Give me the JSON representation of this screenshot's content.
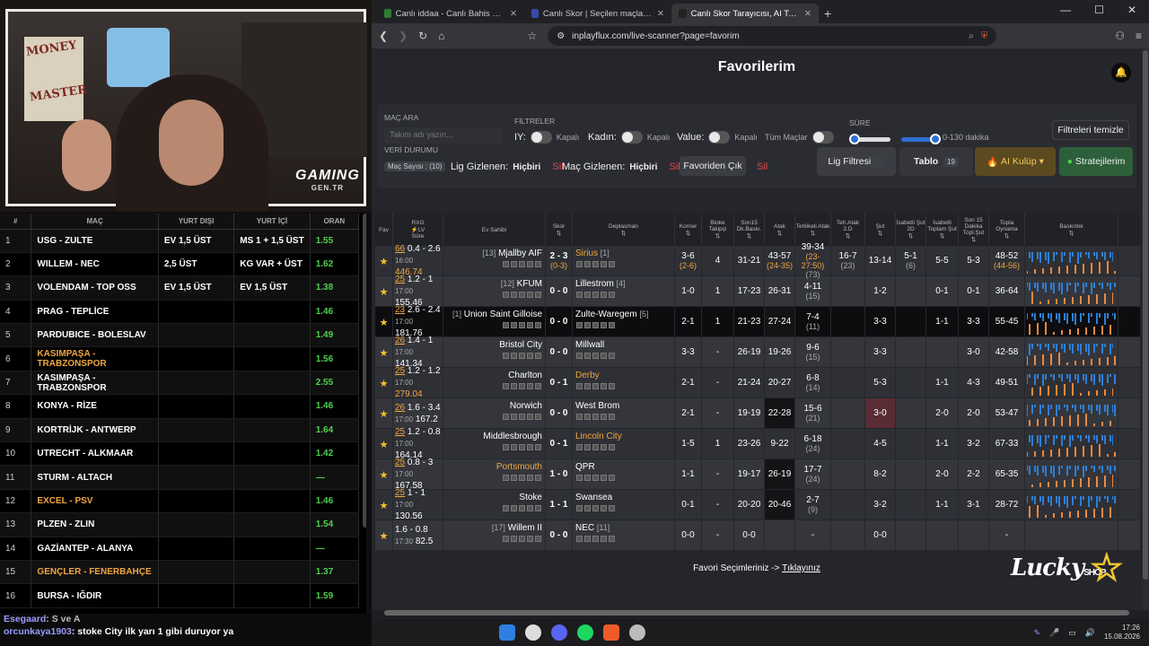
{
  "stream": {
    "logo_text": "GAMING",
    "logo_sub": "GEN.TR",
    "poster_text_1": "MONEY",
    "poster_text_2": "MASTER"
  },
  "left_table": {
    "headers": [
      "#",
      "MAÇ",
      "YURT DIŞI",
      "YURT İÇİ",
      "ORAN"
    ],
    "rows": [
      {
        "n": "1",
        "match": "USG - ZULTE",
        "abroad": "EV 1,5 ÜST",
        "domestic": "MS 1 + 1,5 ÜST",
        "odds": "1.55",
        "highlight": false
      },
      {
        "n": "2",
        "match": "WILLEM - NEC",
        "abroad": "2,5 ÜST",
        "domestic": "KG VAR + ÜST",
        "odds": "1.62",
        "highlight": false
      },
      {
        "n": "3",
        "match": "VOLENDAM - TOP OSS",
        "abroad": "EV 1,5 ÜST",
        "domestic": "EV 1,5 ÜST",
        "odds": "1.38",
        "highlight": false
      },
      {
        "n": "4",
        "match": "PRAG - TEPLİCE",
        "abroad": "",
        "domestic": "",
        "odds": "1.46",
        "highlight": false
      },
      {
        "n": "5",
        "match": "PARDUBICE - BOLESLAV",
        "abroad": "",
        "domestic": "",
        "odds": "1.49",
        "highlight": false
      },
      {
        "n": "6",
        "match": "KASIMPAŞA - TRABZONSPOR",
        "abroad": "",
        "domestic": "",
        "odds": "1.56",
        "highlight": true
      },
      {
        "n": "7",
        "match": "KASIMPAŞA - TRABZONSPOR",
        "abroad": "",
        "domestic": "",
        "odds": "2.55",
        "highlight": false
      },
      {
        "n": "8",
        "match": "KONYA - RİZE",
        "abroad": "",
        "domestic": "",
        "odds": "1.46",
        "highlight": false
      },
      {
        "n": "9",
        "match": "KORTRİJK - ANTWERP",
        "abroad": "",
        "domestic": "",
        "odds": "1.64",
        "highlight": false
      },
      {
        "n": "10",
        "match": "UTRECHT - ALKMAAR",
        "abroad": "",
        "domestic": "",
        "odds": "1.42",
        "highlight": false
      },
      {
        "n": "11",
        "match": "STURM - ALTACH",
        "abroad": "",
        "domestic": "",
        "odds": "—",
        "highlight": false
      },
      {
        "n": "12",
        "match": "EXCEL - PSV",
        "abroad": "",
        "domestic": "",
        "odds": "1.46",
        "highlight": true
      },
      {
        "n": "13",
        "match": "PLZEN - ZLIN",
        "abroad": "",
        "domestic": "",
        "odds": "1.54",
        "highlight": false
      },
      {
        "n": "14",
        "match": "GAZİANTEP - ALANYA",
        "abroad": "",
        "domestic": "",
        "odds": "—",
        "highlight": false
      },
      {
        "n": "15",
        "match": "GENÇLER - FENERBAHÇE",
        "abroad": "",
        "domestic": "",
        "odds": "1.37",
        "highlight": true
      },
      {
        "n": "16",
        "match": "BURSA - IĞDIR",
        "abroad": "",
        "domestic": "",
        "odds": "1.59",
        "highlight": false
      }
    ]
  },
  "chat": [
    {
      "user": "Esegaard",
      "text": ": S ve A"
    },
    {
      "user": "orcunkaya1903",
      "text": ": stoke City ilk yarı 1 gibi duruyor ya"
    }
  ],
  "browser": {
    "tabs": [
      {
        "label": "Canlı iddaa - Canlı Bahis Oyna | iddaa",
        "color": "#2e7d32"
      },
      {
        "label": "Canlı Skor | Seçilen maçlar için canlı",
        "color": "#3949ab"
      },
      {
        "label": "Canlı Skor Tarayıcısı, AI Tahminle",
        "color": "#222222"
      }
    ],
    "url": "inplayflux.com/live-scanner?page=favorim"
  },
  "page": {
    "title": "Favorilerim",
    "filters": {
      "mac_ara": "MAÇ ARA",
      "search_placeholder": "Takım adı yazın...",
      "filtreler": "FİLTRELER",
      "iy": "IY:",
      "kadin": "Kadın:",
      "value": "Value:",
      "tum": "Tüm Maçlar",
      "kapali": "Kapalı",
      "sure": "SÜRE",
      "range": "0-130 dakika",
      "temizle": "Filtreleri temizle",
      "veri": "VERİ DURUMU",
      "mac_sayisi": "Maç Sayısı : (10)",
      "lig_gizlenen": "Lig Gizlenen:",
      "mac_gizlenen": "Maç Gizlenen:",
      "hicbiri": "Hiçbiri",
      "sil": "Sil",
      "favoriden": "Favoriden Çık",
      "lig_filtresi": "Lig Filtresi",
      "tablo": "Tablo",
      "tablo_n": "19",
      "ai": "AI Kulüp",
      "strateji": "Stratejilerim"
    },
    "columns": [
      "Fav",
      "Süre",
      "Ev Sahibi",
      "Skor",
      "Deplasman",
      "Korner",
      "Bloke Takipçi",
      "Son15 Dk.Baskı.",
      "Atak",
      "Tehlikeli Atak",
      "Teh.Atak 2.D",
      "Şut",
      "İsabetli Şut 2D",
      "İsabetli Toplam Şut",
      "Son 15 Dakika Topl.Şut",
      "Topla Oynama",
      "Baskınlık"
    ],
    "col_rxg": "RXG",
    "col_lv": "LV",
    "col_pr": "PR",
    "rows": [
      {
        "min": "66",
        "xg": "0.4 - 2.6",
        "kick": "16:00",
        "pr": "446.74",
        "pr_orange": true,
        "home": "Mjallby AIF",
        "home_rank": "[13]",
        "score": "2 - 3",
        "score_sub": "(0-3)",
        "away": "Sirius",
        "away_rank": "[1]",
        "away_orange": true,
        "k": "3-6",
        "k2": "(2-6)",
        "b": "4",
        "s15": "31-21",
        "atak": "43-57",
        "atak2": "(24-35)",
        "teh": "39-34",
        "teh2": "(23-27:50)",
        "teh3": "(73)",
        "teh2d": "16-7",
        "teh2d2": "(23)",
        "sut": "13-14",
        "isb": "5-1",
        "isb2": "(6)",
        "ist": "5-5",
        "son15": "5-3",
        "top": "48-52",
        "top2": "(44-56)",
        "dark": false
      },
      {
        "min": "25",
        "xg": "1.2 - 1",
        "kick": "17:00",
        "pr": "155.46",
        "pr_orange": false,
        "home": "KFUM",
        "home_rank": "[12]",
        "score": "0 - 0",
        "score_sub": "",
        "away": "Lillestrom",
        "away_rank": "[4]",
        "away_orange": false,
        "k": "1-0",
        "k2": "",
        "b": "1",
        "s15": "17-23",
        "atak": "26-31",
        "atak2": "",
        "teh": "4-11",
        "teh2": "(15)",
        "teh3": "",
        "teh2d": "",
        "teh2d2": "",
        "sut": "1-2",
        "isb": "",
        "isb2": "",
        "ist": "0-1",
        "son15": "0-1",
        "top": "36-64",
        "top2": "",
        "dark": false
      },
      {
        "min": "23",
        "xg": "2.6 - 2.4",
        "kick": "17:00",
        "pr": "181.76",
        "pr_orange": false,
        "home": "Union Saint Gilloise",
        "home_rank": "[1]",
        "score": "0 - 0",
        "score_sub": "",
        "away": "Zulte-Waregem",
        "away_rank": "[5]",
        "away_orange": false,
        "k": "2-1",
        "k2": "",
        "b": "1",
        "s15": "21-23",
        "atak": "27-24",
        "atak2": "",
        "teh": "7-4",
        "teh2": "(11)",
        "teh3": "",
        "teh2d": "",
        "teh2d2": "",
        "sut": "3-3",
        "isb": "",
        "isb2": "",
        "ist": "1-1",
        "son15": "3-3",
        "top": "55-45",
        "top2": "",
        "dark": true
      },
      {
        "min": "26",
        "xg": "1.4 - 1",
        "kick": "17:00",
        "pr": "141.34",
        "pr_orange": false,
        "home": "Bristol City",
        "home_rank": "",
        "score": "0 - 0",
        "score_sub": "",
        "away": "Millwall",
        "away_rank": "",
        "away_orange": false,
        "k": "3-3",
        "k2": "",
        "b": "-",
        "s15": "26-19",
        "atak": "19-26",
        "atak2": "",
        "teh": "9-6",
        "teh2": "(15)",
        "teh3": "",
        "teh2d": "",
        "teh2d2": "",
        "sut": "3-3",
        "isb": "",
        "isb2": "",
        "ist": "",
        "son15": "3-0",
        "top": "42-58",
        "top2": "",
        "dark": false
      },
      {
        "min": "25",
        "xg": "1.2 - 1.2",
        "kick": "17:00",
        "pr": "279.04",
        "pr_orange": true,
        "home": "Charlton",
        "home_rank": "",
        "score": "0 - 1",
        "score_sub": "",
        "away": "Derby",
        "away_rank": "",
        "away_orange": true,
        "k": "2-1",
        "k2": "",
        "b": "-",
        "s15": "21-24",
        "atak": "20-27",
        "atak2": "",
        "teh": "6-8",
        "teh2": "(14)",
        "teh3": "",
        "teh2d": "",
        "teh2d2": "",
        "sut": "5-3",
        "isb": "",
        "isb2": "",
        "ist": "1-1",
        "son15": "4-3",
        "top": "49-51",
        "top2": "",
        "dark": false
      },
      {
        "min": "26",
        "xg": "1.6 - 3.4",
        "kick": "17:00",
        "pr": "167.2",
        "pr_orange": false,
        "home": "Norwich",
        "home_rank": "",
        "score": "0 - 0",
        "score_sub": "",
        "away": "West Brom",
        "away_rank": "",
        "away_orange": false,
        "k": "2-1",
        "k2": "",
        "b": "-",
        "s15": "19-19",
        "atak": "22-28",
        "atak2": "",
        "teh": "15-6",
        "teh2": "(21)",
        "teh3": "",
        "teh2d": "",
        "teh2d2": "",
        "sut": "3-0",
        "isb": "",
        "isb2": "",
        "ist": "2-0",
        "son15": "2-0",
        "top": "53-47",
        "top2": "",
        "dark": false
      },
      {
        "min": "25",
        "xg": "1.2 - 0.8",
        "kick": "17:00",
        "pr": "164.14",
        "pr_orange": false,
        "home": "Middlesbrough",
        "home_rank": "",
        "score": "0 - 1",
        "score_sub": "",
        "away": "Lincoln City",
        "away_rank": "",
        "away_orange": true,
        "k": "1-5",
        "k2": "",
        "b": "1",
        "s15": "23-26",
        "atak": "9-22",
        "atak2": "",
        "teh": "6-18",
        "teh2": "(24)",
        "teh3": "",
        "teh2d": "",
        "teh2d2": "",
        "sut": "4-5",
        "isb": "",
        "isb2": "",
        "ist": "1-1",
        "son15": "3-2",
        "top": "67-33",
        "top2": "",
        "dark": false
      },
      {
        "min": "25",
        "xg": "0.8 - 3",
        "kick": "17:00",
        "pr": "167.58",
        "pr_orange": false,
        "home": "Portsmouth",
        "home_rank": "",
        "score": "1 - 0",
        "score_sub": "",
        "away": "QPR",
        "away_rank": "",
        "away_orange": false,
        "home_orange": true,
        "k": "1-1",
        "k2": "",
        "b": "-",
        "s15": "19-17",
        "atak": "26-19",
        "atak2": "",
        "teh": "17-7",
        "teh2": "(24)",
        "teh3": "",
        "teh2d": "",
        "teh2d2": "",
        "sut": "8-2",
        "isb": "",
        "isb2": "",
        "ist": "2-0",
        "son15": "2-2",
        "top": "65-35",
        "top2": "",
        "dark": false
      },
      {
        "min": "25",
        "xg": "1 - 1",
        "kick": "17:00",
        "pr": "130.56",
        "pr_orange": false,
        "home": "Stoke",
        "home_rank": "",
        "score": "1 - 1",
        "score_sub": "",
        "away": "Swansea",
        "away_rank": "",
        "away_orange": false,
        "k": "0-1",
        "k2": "",
        "b": "-",
        "s15": "20-20",
        "atak": "20-46",
        "atak2": "",
        "teh": "2-7",
        "teh2": "(9)",
        "teh3": "",
        "teh2d": "",
        "teh2d2": "",
        "sut": "3-2",
        "isb": "",
        "isb2": "",
        "ist": "1-1",
        "son15": "3-1",
        "top": "28-72",
        "top2": "",
        "dark": false
      },
      {
        "min": "",
        "xg": "1.6 - 0.8",
        "kick": "17:30",
        "pr": "82.5",
        "pr_orange": false,
        "home": "Willem II",
        "home_rank": "[17]",
        "score": "0 - 0",
        "score_sub": "",
        "away": "NEC",
        "away_rank": "[11]",
        "away_orange": false,
        "k": "0-0",
        "k2": "",
        "b": "-",
        "s15": "0-0",
        "atak": "",
        "atak2": "",
        "teh": "-",
        "teh2": "",
        "teh3": "",
        "teh2d": "",
        "teh2d2": "",
        "sut": "0-0",
        "isb": "",
        "isb2": "",
        "ist": "",
        "son15": "",
        "top": "-",
        "top2": "",
        "dark": false
      }
    ],
    "footer": "Favori Seçimleriniz ->",
    "footer_link": "Tıklayınız"
  },
  "taskbar": {
    "time": "17:26",
    "date": "15.08.2026"
  },
  "watermark": {
    "text": "Lucky",
    "shop": "SHOP"
  }
}
